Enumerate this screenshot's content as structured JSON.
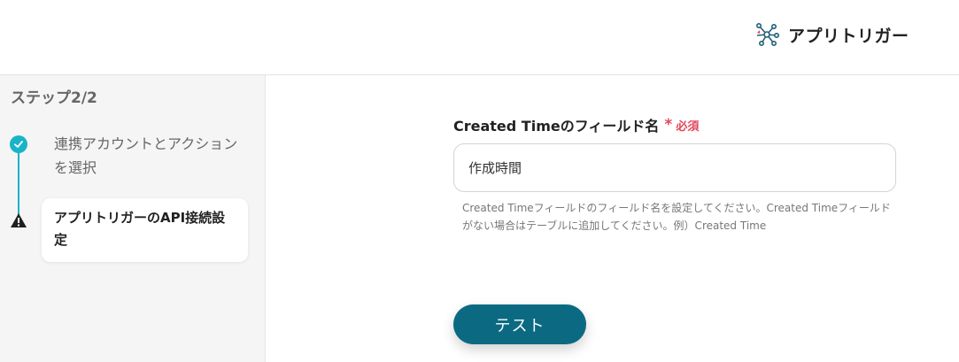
{
  "header": {
    "title": "アプリトリガー",
    "icon": "app-trigger-network-icon"
  },
  "sidebar": {
    "step_count": "ステップ2/2",
    "steps": [
      {
        "label": "連携アカウントとアクションを選択",
        "status": "completed",
        "icon": "check-circle-icon"
      },
      {
        "label": "アプリトリガーのAPI接続設定",
        "status": "current-warning",
        "icon": "warning-icon"
      }
    ],
    "accent_color": "#19b4c7"
  },
  "form": {
    "field_label": "Created Timeのフィールド名",
    "required_mark": "*",
    "required_text": "必須",
    "field_value": "作成時間",
    "help_text": "Created Timeフィールドのフィールド名を設定してください。Created Timeフィールドがない場合はテーブルに追加してください。例）Created Time",
    "required_color": "#e0485a"
  },
  "actions": {
    "test_label": "テスト",
    "button_color": "#0b6a82"
  }
}
